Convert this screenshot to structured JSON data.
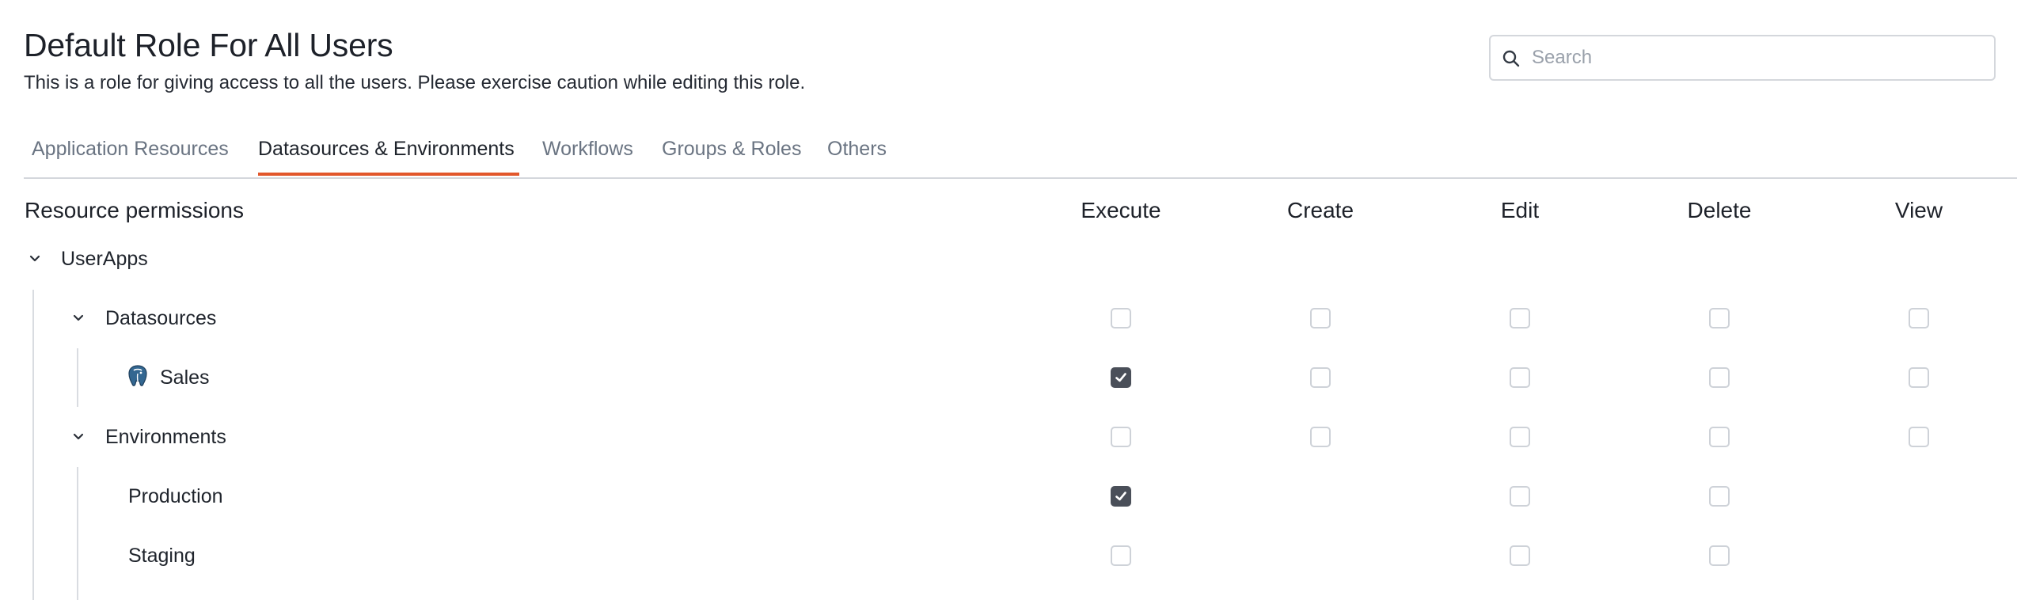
{
  "header": {
    "title": "Default Role For All Users",
    "subtitle": "This is a role for giving access to all the users. Please exercise caution while editing this role."
  },
  "search": {
    "placeholder": "Search",
    "value": ""
  },
  "tabs": [
    {
      "label": "Application Resources",
      "active": false
    },
    {
      "label": "Datasources & Environments",
      "active": true
    },
    {
      "label": "Workflows",
      "active": false
    },
    {
      "label": "Groups & Roles",
      "active": false
    },
    {
      "label": "Others",
      "active": false
    }
  ],
  "table": {
    "resource_header": "Resource permissions",
    "columns": [
      "Execute",
      "Create",
      "Edit",
      "Delete",
      "View"
    ],
    "rows": [
      {
        "label": "UserApps",
        "expanded": true,
        "level": 0,
        "checkboxes": [
          null,
          null,
          null,
          null,
          null
        ]
      },
      {
        "label": "Datasources",
        "expanded": true,
        "level": 1,
        "checkboxes": [
          false,
          false,
          false,
          false,
          false
        ]
      },
      {
        "label": "Sales",
        "level": 2,
        "icon": "postgres-elephant-icon",
        "checkboxes": [
          true,
          false,
          false,
          false,
          false
        ]
      },
      {
        "label": "Environments",
        "expanded": true,
        "level": 1,
        "checkboxes": [
          false,
          false,
          false,
          false,
          false
        ]
      },
      {
        "label": "Production",
        "level": 2,
        "checkboxes": [
          true,
          null,
          false,
          false,
          null
        ]
      },
      {
        "label": "Staging",
        "level": 2,
        "checkboxes": [
          false,
          null,
          false,
          false,
          null
        ]
      }
    ]
  },
  "colors": {
    "accent": "#e2572b",
    "checked": "#4a4f59",
    "border": "#d4d7dc"
  }
}
